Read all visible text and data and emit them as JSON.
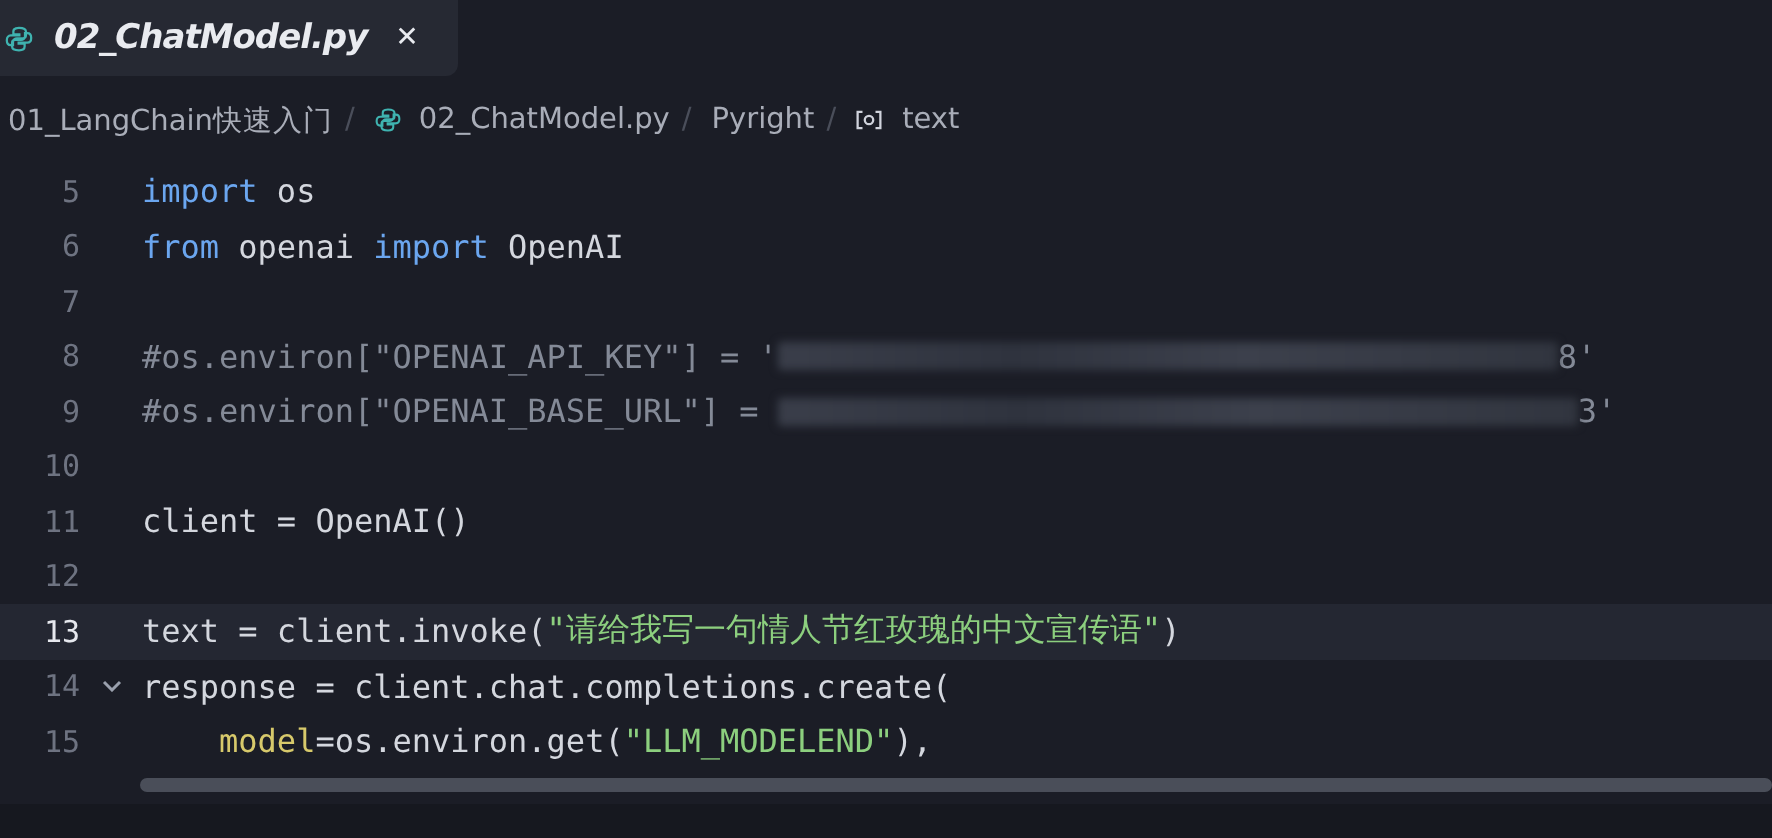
{
  "tabs": [
    {
      "label": "02_ChatModel.py",
      "selected": true,
      "close": "✕"
    }
  ],
  "breadcrumb": [
    {
      "label": "01_LangChain快速入门",
      "kind": "folder"
    },
    {
      "separator": "/",
      "label": "02_ChatModel.py",
      "kind": "file"
    },
    {
      "separator": "/",
      "label": "Pyright",
      "kind": "tool"
    },
    {
      "separator": "/",
      "label": "text",
      "kind": "symbol"
    }
  ],
  "lines": [
    {
      "number": "5",
      "current": false,
      "foldable": false,
      "tokens": [
        {
          "kind": "kw",
          "text": "import"
        },
        {
          "kind": "plain",
          "text": " os"
        }
      ]
    },
    {
      "number": "6",
      "current": false,
      "foldable": false,
      "tokens": [
        {
          "kind": "kw",
          "text": "from"
        },
        {
          "kind": "plain",
          "text": " openai "
        },
        {
          "kind": "kw",
          "text": "import"
        },
        {
          "kind": "plain",
          "text": " OpenAI"
        }
      ]
    },
    {
      "number": "7",
      "current": false,
      "foldable": false
    },
    {
      "number": "8",
      "current": false,
      "foldable": false,
      "tokens": [
        {
          "kind": "comment",
          "text": "#os.environ[\"OPENAI_API_KEY\"] = '"
        },
        {
          "kind": "redacted"
        },
        {
          "kind": "comment",
          "text": "8'"
        }
      ]
    },
    {
      "number": "9",
      "current": false,
      "foldable": false,
      "tokens": [
        {
          "kind": "comment",
          "text": "#os.environ[\"OPENAI_BASE_URL\"] = "
        },
        {
          "kind": "redacted"
        },
        {
          "kind": "comment",
          "text": "3'"
        }
      ]
    },
    {
      "number": "10",
      "current": false,
      "foldable": false
    },
    {
      "number": "11",
      "current": false,
      "foldable": false,
      "tokens": [
        {
          "kind": "plain",
          "text": "client = OpenAI()"
        }
      ]
    },
    {
      "number": "12",
      "current": false,
      "foldable": false
    },
    {
      "number": "13",
      "current": true,
      "foldable": false,
      "tokens": [
        {
          "kind": "plain",
          "text": "text = client.invoke("
        },
        {
          "kind": "str",
          "text": "\"请给我写一句情人节红玫瑰的中文宣传语\""
        },
        {
          "kind": "plain",
          "text": ")"
        }
      ]
    },
    {
      "number": "14",
      "current": false,
      "foldable": true,
      "tokens": [
        {
          "kind": "plain",
          "text": "response = client.chat.completions.create("
        }
      ]
    },
    {
      "number": "15",
      "current": false,
      "foldable": false,
      "indent": true,
      "tokens": [
        {
          "kind": "param",
          "text": "model"
        },
        {
          "kind": "plain",
          "text": "=os.environ.get("
        },
        {
          "kind": "str",
          "text": "\"LLM_MODELEND\""
        },
        {
          "kind": "plain",
          "text": "),"
        }
      ]
    }
  ]
}
